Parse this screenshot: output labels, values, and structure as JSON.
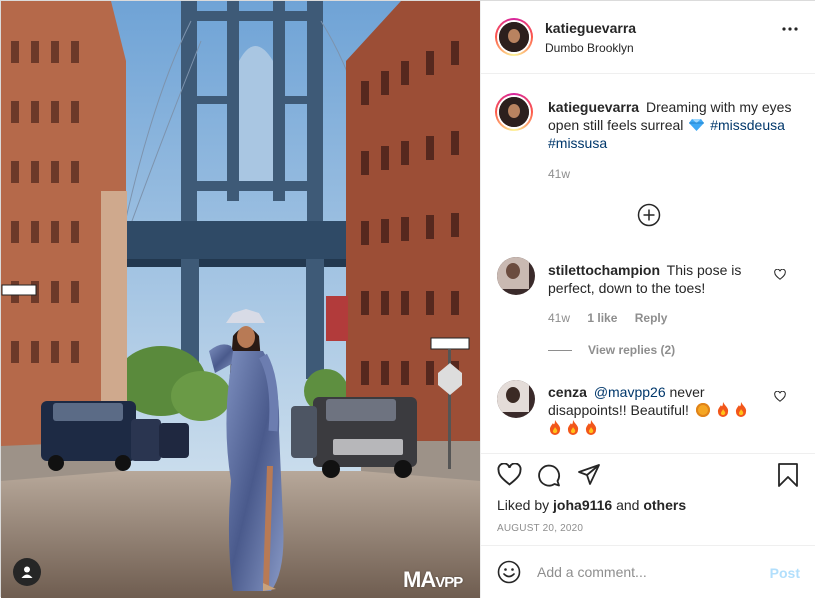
{
  "post": {
    "username": "katieguevarra",
    "location": "Dumbo Brooklyn",
    "caption": {
      "username": "katieguevarra",
      "text": "Dreaming with my eyes open still feels surreal",
      "hashtag1": "#missdeusa",
      "hashtag2": "#missusa",
      "age": "41w"
    },
    "photo": {
      "watermark_main": "MA",
      "watermark_sub": "VPP",
      "street_sign_1": "ONE WAY",
      "street_sign_2": "ONE WAY"
    }
  },
  "comments": [
    {
      "username": "stilettochampion",
      "text": "This pose is perfect, down to the toes!",
      "age": "41w",
      "likes": "1 like",
      "reply_label": "Reply",
      "view_replies": "View replies (2)"
    },
    {
      "username": "cenza",
      "mention": "@mavpp26",
      "text": "never disappoints!! Beautiful!"
    }
  ],
  "actions": {
    "liked_by_prefix": "Liked by",
    "liked_by_user": "joha9116",
    "liked_by_and": "and",
    "liked_by_others": "others",
    "date": "AUGUST 20, 2020"
  },
  "composer": {
    "placeholder": "Add a comment...",
    "post_label": "Post"
  },
  "icons": {
    "more": "more-options-icon",
    "like": "heart-icon",
    "comment": "comment-icon",
    "share": "paper-plane-icon",
    "save": "bookmark-icon",
    "emoji": "smiley-icon",
    "load_more": "plus-circle-icon",
    "tag": "user-tag-icon"
  },
  "colors": {
    "hashtag": "#00376b",
    "muted": "#8e8e8e",
    "post_disabled": "#b2dffc",
    "diamond": "#3fa9f5",
    "fire": "#f2561a"
  }
}
